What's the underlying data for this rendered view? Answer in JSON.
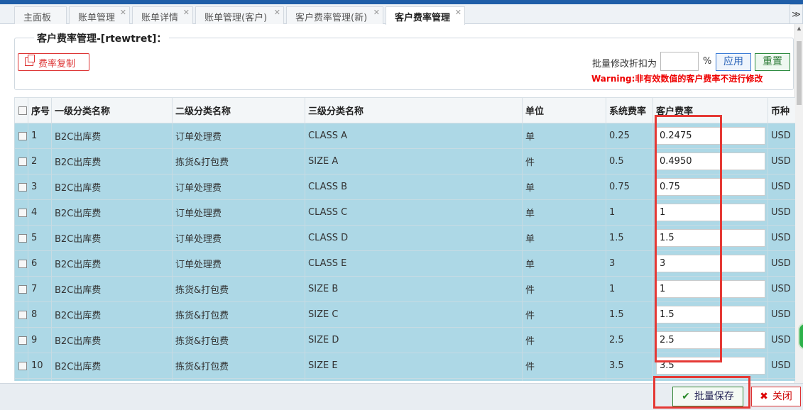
{
  "tabs": [
    {
      "label": "主面板",
      "closable": false
    },
    {
      "label": "账单管理",
      "closable": true
    },
    {
      "label": "账单详情",
      "closable": true
    },
    {
      "label": "账单管理(客户)",
      "closable": true
    },
    {
      "label": "客户费率管理(新)",
      "closable": true
    },
    {
      "label": "客户费率管理",
      "closable": true,
      "active": true
    }
  ],
  "tab_close_glyph": "✕",
  "tab_scroll_glyph": "≫",
  "section": {
    "title": "客户费率管理-[rtewtret]："
  },
  "toolbar": {
    "copy_label": "费率复制",
    "discount_label": "批量修改折扣为",
    "discount_value": "",
    "percent_sign": "%",
    "apply_label": "应用",
    "reset_label": "重置",
    "warning": "Warning:非有效数值的客户费率不进行修改"
  },
  "table": {
    "headers": [
      "序号",
      "一级分类名称",
      "二级分类名称",
      "三级分类名称",
      "单位",
      "系统费率",
      "客户费率",
      "币种"
    ],
    "rows": [
      {
        "no": "1",
        "cat1": "B2C出库费",
        "cat2": "订单处理费",
        "cat3": "CLASS A",
        "unit": "单",
        "sys_rate": "0.25",
        "cust_rate": "0.2475",
        "currency": "USD"
      },
      {
        "no": "2",
        "cat1": "B2C出库费",
        "cat2": "拣货&打包费",
        "cat3": "SIZE A",
        "unit": "件",
        "sys_rate": "0.5",
        "cust_rate": "0.4950",
        "currency": "USD"
      },
      {
        "no": "3",
        "cat1": "B2C出库费",
        "cat2": "订单处理费",
        "cat3": "CLASS B",
        "unit": "单",
        "sys_rate": "0.75",
        "cust_rate": "0.75",
        "currency": "USD"
      },
      {
        "no": "4",
        "cat1": "B2C出库费",
        "cat2": "订单处理费",
        "cat3": "CLASS C",
        "unit": "单",
        "sys_rate": "1",
        "cust_rate": "1",
        "currency": "USD"
      },
      {
        "no": "5",
        "cat1": "B2C出库费",
        "cat2": "订单处理费",
        "cat3": "CLASS D",
        "unit": "单",
        "sys_rate": "1.5",
        "cust_rate": "1.5",
        "currency": "USD"
      },
      {
        "no": "6",
        "cat1": "B2C出库费",
        "cat2": "订单处理费",
        "cat3": "CLASS E",
        "unit": "单",
        "sys_rate": "3",
        "cust_rate": "3",
        "currency": "USD"
      },
      {
        "no": "7",
        "cat1": "B2C出库费",
        "cat2": "拣货&打包费",
        "cat3": "SIZE B",
        "unit": "件",
        "sys_rate": "1",
        "cust_rate": "1",
        "currency": "USD"
      },
      {
        "no": "8",
        "cat1": "B2C出库费",
        "cat2": "拣货&打包费",
        "cat3": "SIZE C",
        "unit": "件",
        "sys_rate": "1.5",
        "cust_rate": "1.5",
        "currency": "USD"
      },
      {
        "no": "9",
        "cat1": "B2C出库费",
        "cat2": "拣货&打包费",
        "cat3": "SIZE D",
        "unit": "件",
        "sys_rate": "2.5",
        "cust_rate": "2.5",
        "currency": "USD"
      },
      {
        "no": "10",
        "cat1": "B2C出库费",
        "cat2": "拣货&打包费",
        "cat3": "SIZE E",
        "unit": "件",
        "sys_rate": "3.5",
        "cust_rate": "3.5",
        "currency": "USD"
      },
      {
        "no": "",
        "cat1": "",
        "cat2": "",
        "cat3": "",
        "unit": "",
        "sys_rate": "",
        "cust_rate": "",
        "currency": ""
      }
    ]
  },
  "footer": {
    "save_label": "批量保存",
    "close_label": "关闭",
    "save_icon": "✔",
    "close_icon": "✖"
  },
  "colors": {
    "row_bg": "#add8e6",
    "warning": "#ee0000",
    "highlight": "#e53935"
  }
}
